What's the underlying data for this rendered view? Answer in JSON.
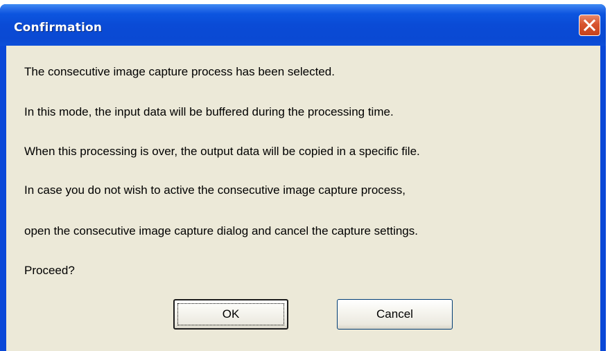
{
  "window": {
    "title": "Confirmation"
  },
  "message": {
    "lines": [
      "The consecutive image capture process has been selected.",
      "In this mode, the input data will be buffered during the processing time.",
      "When this processing is over, the output data will be copied in a specific file.",
      "In case you do not wish to active the consecutive image capture process,",
      "open the consecutive image capture dialog and cancel the capture settings.",
      "Proceed?"
    ]
  },
  "buttons": {
    "ok_label": "OK",
    "cancel_label": "Cancel"
  },
  "icons": {
    "close": "close-icon"
  },
  "colors": {
    "titlebar": "#0a4bd6",
    "client_background": "#ece9d8",
    "close_button": "#d8542e"
  }
}
